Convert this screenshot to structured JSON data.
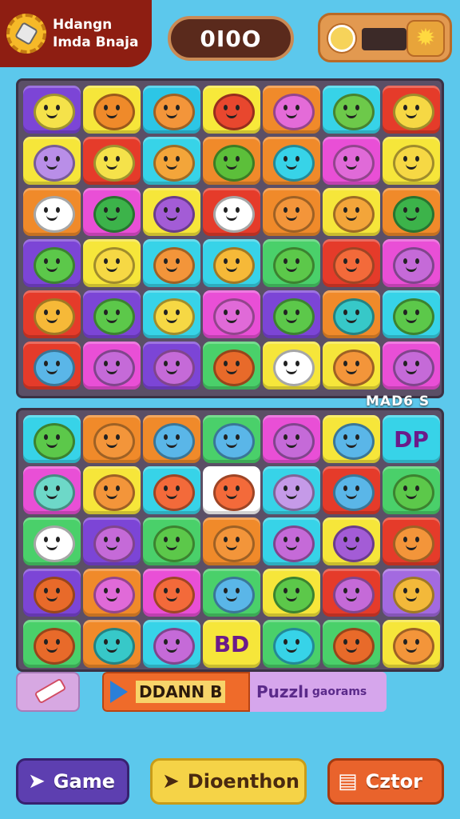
{
  "brand": {
    "line1": "Hdangn",
    "line2": "Imda Bnaja",
    "icon": "gear-icon"
  },
  "score": {
    "value": "0I0O"
  },
  "meter": {
    "coin_icon": "coin-icon",
    "settings_icon": "gear-icon",
    "fill": 0.0
  },
  "colors": {
    "background": "#5cc8ec",
    "board": "#5b4f66",
    "header": "#8e1e12"
  },
  "board_top": {
    "rows": [
      [
        {
          "bg": "#7c45d6",
          "c": "#f5e24a"
        },
        {
          "bg": "#f6e63a",
          "c": "#ef8a2a"
        },
        {
          "bg": "#2cc6e6",
          "c": "#f3953a"
        },
        {
          "bg": "#f7e93a",
          "c": "#e8472e"
        },
        {
          "bg": "#f08a2a",
          "c": "#e46bd8"
        },
        {
          "bg": "#37d3e8",
          "c": "#6dc94a"
        },
        {
          "bg": "#e53b2a",
          "c": "#f6d844"
        }
      ],
      [
        {
          "bg": "#f6e63a",
          "c": "#b98ee8"
        },
        {
          "bg": "#e53b2a",
          "c": "#f5e24a"
        },
        {
          "bg": "#37d3e8",
          "c": "#f3a53a"
        },
        {
          "bg": "#f08a2a",
          "c": "#5cbf3a"
        },
        {
          "bg": "#f08a2a",
          "c": "#37d3e8"
        },
        {
          "bg": "#e94fd6",
          "c": "#e06ad8"
        },
        {
          "bg": "#f6e63a",
          "c": "#f6d844"
        }
      ],
      [
        {
          "bg": "#f08a2a",
          "c": "#ffffff"
        },
        {
          "bg": "#e94fd6",
          "c": "#3cb34a"
        },
        {
          "bg": "#f6e63a",
          "c": "#a35cd6"
        },
        {
          "bg": "#e53b2a",
          "c": "#ffffff"
        },
        {
          "bg": "#f08a2a",
          "c": "#f3953a"
        },
        {
          "bg": "#f6e63a",
          "c": "#f3a53a"
        },
        {
          "bg": "#f08a2a",
          "c": "#3cb34a"
        }
      ],
      [
        {
          "bg": "#7c45d6",
          "c": "#5cc84a"
        },
        {
          "bg": "#f6e63a",
          "c": "#f6d844"
        },
        {
          "bg": "#37d3e8",
          "c": "#f3953a"
        },
        {
          "bg": "#37d3e8",
          "c": "#f6b938"
        },
        {
          "bg": "#4ad06a",
          "c": "#5cc84a"
        },
        {
          "bg": "#e53b2a",
          "c": "#f36a3a"
        },
        {
          "bg": "#e94fd6",
          "c": "#c56ad8"
        }
      ],
      [
        {
          "bg": "#e53b2a",
          "c": "#f6b938"
        },
        {
          "bg": "#7c45d6",
          "c": "#5cc84a"
        },
        {
          "bg": "#37d3e8",
          "c": "#f6d844"
        },
        {
          "bg": "#e94fd6",
          "c": "#e06ad8"
        },
        {
          "bg": "#7c45d6",
          "c": "#5cc84a"
        },
        {
          "bg": "#f08a2a",
          "c": "#37c8c8"
        },
        {
          "bg": "#37d3e8",
          "c": "#5cc84a"
        }
      ],
      [
        {
          "bg": "#e53b2a",
          "c": "#5ab6e8"
        },
        {
          "bg": "#e94fd6",
          "c": "#c56ad8"
        },
        {
          "bg": "#7c45d6",
          "c": "#c56ad8"
        },
        {
          "bg": "#4ad06a",
          "c": "#e86a2a"
        },
        {
          "bg": "#f6e63a",
          "c": "#ffffff"
        },
        {
          "bg": "#f6e63a",
          "c": "#f3953a"
        },
        {
          "bg": "#e94fd6",
          "c": "#c56ad8"
        }
      ]
    ]
  },
  "section_label": "MAD6 S",
  "board_bottom": {
    "rows": [
      [
        {
          "bg": "#37d3e8",
          "c": "#5cc84a"
        },
        {
          "bg": "#f08a2a",
          "c": "#f3953a"
        },
        {
          "bg": "#f08a2a",
          "c": "#5ab6e8"
        },
        {
          "bg": "#4ad06a",
          "c": "#5ab6e8"
        },
        {
          "bg": "#e94fd6",
          "c": "#c56ad8"
        },
        {
          "bg": "#f6e63a",
          "c": "#5ab6e8"
        },
        {
          "bg": "#37d3e8",
          "label": "DP"
        }
      ],
      [
        {
          "bg": "#e94fd6",
          "c": "#6dd8c8"
        },
        {
          "bg": "#f6e63a",
          "c": "#f3953a"
        },
        {
          "bg": "#37d3e8",
          "c": "#f36a3a"
        },
        {
          "bg": "#ffffff",
          "c": "#f36a3a"
        },
        {
          "bg": "#37d3e8",
          "c": "#c59ae8"
        },
        {
          "bg": "#e53b2a",
          "c": "#5ab6e8"
        },
        {
          "bg": "#4ad06a",
          "c": "#5cc84a"
        }
      ],
      [
        {
          "bg": "#4ad06a",
          "c": "#ffffff"
        },
        {
          "bg": "#7c45d6",
          "c": "#c56ad8"
        },
        {
          "bg": "#4ad06a",
          "c": "#5cc84a"
        },
        {
          "bg": "#f08a2a",
          "c": "#f3953a"
        },
        {
          "bg": "#37d3e8",
          "c": "#c56ad8"
        },
        {
          "bg": "#f6e63a",
          "c": "#a35cd6"
        },
        {
          "bg": "#e53b2a",
          "c": "#f3953a"
        }
      ],
      [
        {
          "bg": "#7c45d6",
          "c": "#e86a2a"
        },
        {
          "bg": "#f08a2a",
          "c": "#e06ad8"
        },
        {
          "bg": "#e94fd6",
          "c": "#f36a3a"
        },
        {
          "bg": "#4ad06a",
          "c": "#5ab6e8"
        },
        {
          "bg": "#f6e63a",
          "c": "#5cc84a"
        },
        {
          "bg": "#e53b2a",
          "c": "#c56ad8"
        },
        {
          "bg": "#a36ae0",
          "c": "#f3b93a"
        }
      ],
      [
        {
          "bg": "#4ad06a",
          "c": "#e86a2a"
        },
        {
          "bg": "#f08a2a",
          "c": "#37c8c8"
        },
        {
          "bg": "#37d3e8",
          "c": "#c56ad8"
        },
        {
          "bg": "#f6e63a",
          "label": "BD"
        },
        {
          "bg": "#4ad06a",
          "c": "#37d3e8"
        },
        {
          "bg": "#4ad06a",
          "c": "#e86a2a"
        },
        {
          "bg": "#f6e63a",
          "c": "#f3953a"
        }
      ]
    ]
  },
  "banner": {
    "left_text": "DDANN B",
    "right_text": "Puzzlı",
    "right_small": "gaorams",
    "play_icon": "play-icon"
  },
  "small_button_icon": "eraser-icon",
  "buttons": {
    "game": {
      "label": "Game",
      "icon": "cursor-icon"
    },
    "direction": {
      "label": "Dioenthon",
      "icon": "cursor-icon"
    },
    "editor": {
      "label": "Cztor",
      "icon": "card-icon"
    }
  }
}
